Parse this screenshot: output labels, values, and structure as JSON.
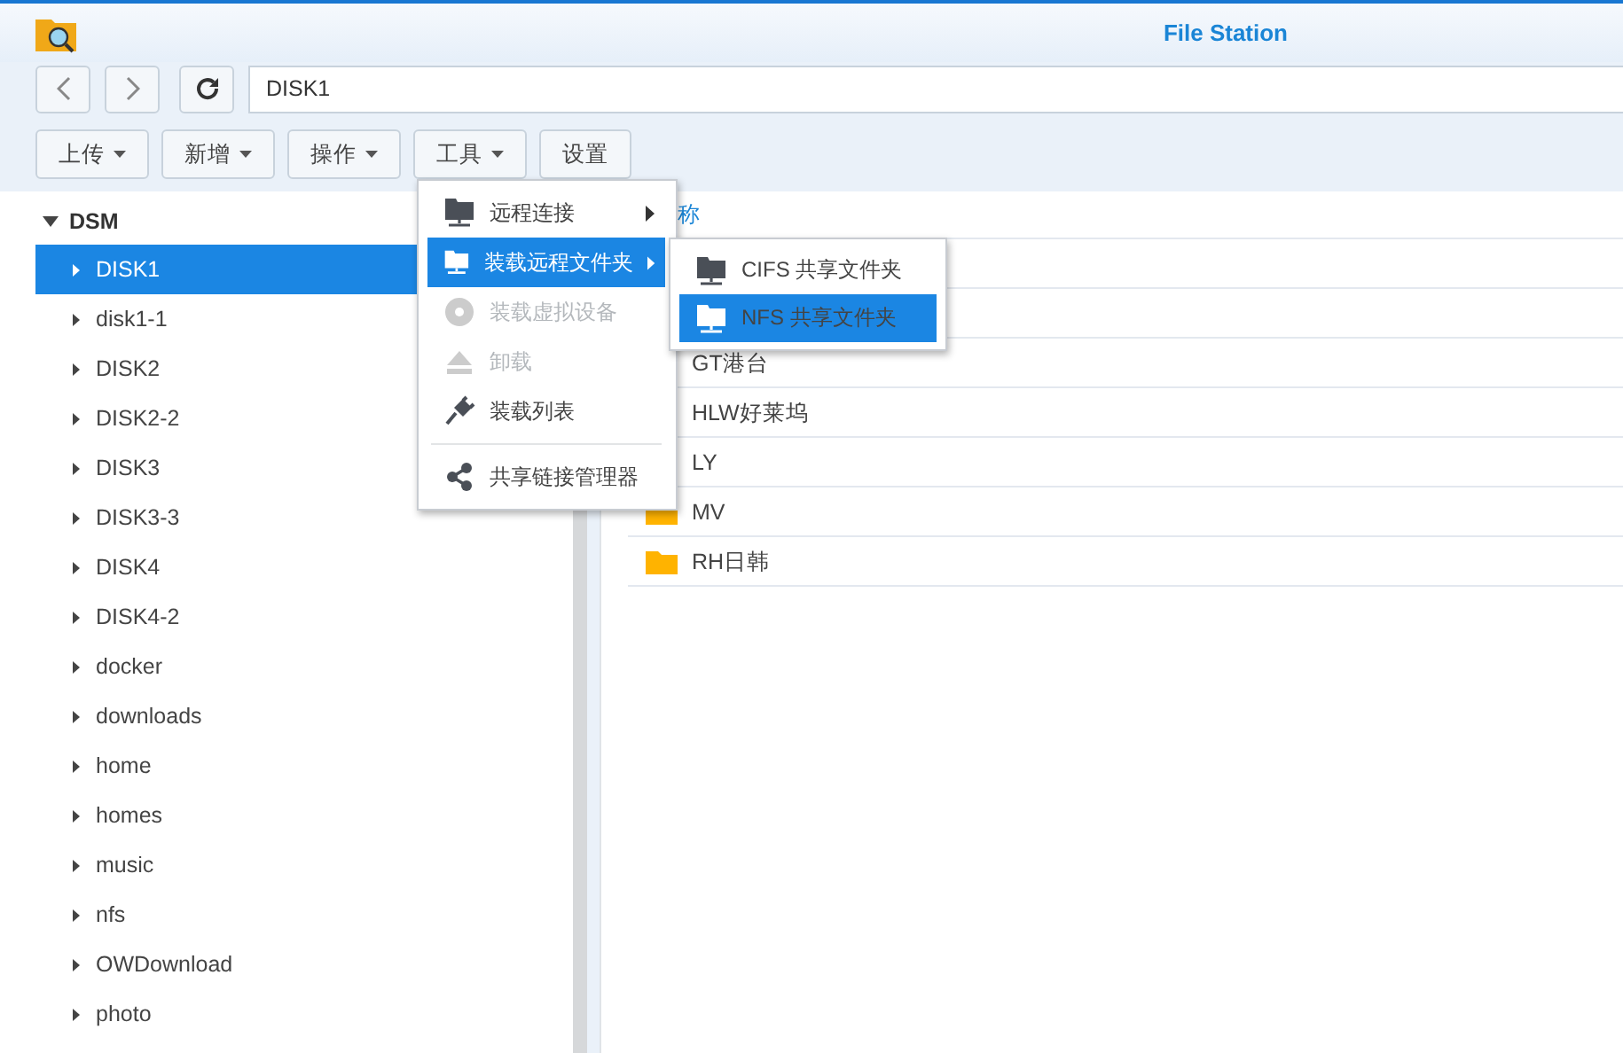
{
  "window": {
    "title": "File Station"
  },
  "path_field": {
    "value": "DISK1"
  },
  "toolbar": [
    {
      "label": "上传",
      "dropdown": true
    },
    {
      "label": "新增",
      "dropdown": true
    },
    {
      "label": "操作",
      "dropdown": true
    },
    {
      "label": "工具",
      "dropdown": true
    },
    {
      "label": "设置",
      "dropdown": false
    }
  ],
  "tree": {
    "root": "DSM",
    "expanded": true,
    "items": [
      {
        "label": "DISK1",
        "selected": true
      },
      {
        "label": "disk1-1",
        "selected": false
      },
      {
        "label": "DISK2",
        "selected": false
      },
      {
        "label": "DISK2-2",
        "selected": false
      },
      {
        "label": "DISK3",
        "selected": false
      },
      {
        "label": "DISK3-3",
        "selected": false
      },
      {
        "label": "DISK4",
        "selected": false
      },
      {
        "label": "DISK4-2",
        "selected": false
      },
      {
        "label": "docker",
        "selected": false
      },
      {
        "label": "downloads",
        "selected": false
      },
      {
        "label": "home",
        "selected": false
      },
      {
        "label": "homes",
        "selected": false
      },
      {
        "label": "music",
        "selected": false
      },
      {
        "label": "nfs",
        "selected": false
      },
      {
        "label": "OWDownload",
        "selected": false
      },
      {
        "label": "photo",
        "selected": false
      }
    ]
  },
  "file_list": {
    "column_1": "称",
    "rows": [
      {
        "name": "GT港台"
      },
      {
        "name": "HLW好莱坞"
      },
      {
        "name": "LY"
      },
      {
        "name": "MV"
      },
      {
        "name": "RH日韩"
      }
    ]
  },
  "menu": [
    {
      "kind": "network",
      "label": "远程连接",
      "submenu": true,
      "selected": false,
      "disabled": false
    },
    {
      "kind": "network",
      "label": "装载远程文件夹",
      "submenu": true,
      "selected": true,
      "disabled": false
    },
    {
      "kind": "disc",
      "label": "装载虚拟设备",
      "submenu": false,
      "selected": false,
      "disabled": true
    },
    {
      "kind": "eject",
      "label": "卸载",
      "submenu": false,
      "selected": false,
      "disabled": true
    },
    {
      "kind": "plug",
      "label": "装载列表",
      "submenu": false,
      "selected": false,
      "disabled": false
    },
    {
      "kind": "separator"
    },
    {
      "kind": "share",
      "label": "共享链接管理器",
      "submenu": false,
      "selected": false,
      "disabled": false
    }
  ],
  "submenu": [
    {
      "label": "CIFS 共享文件夹",
      "selected": false
    },
    {
      "label": "NFS 共享文件夹",
      "selected": true
    }
  ]
}
